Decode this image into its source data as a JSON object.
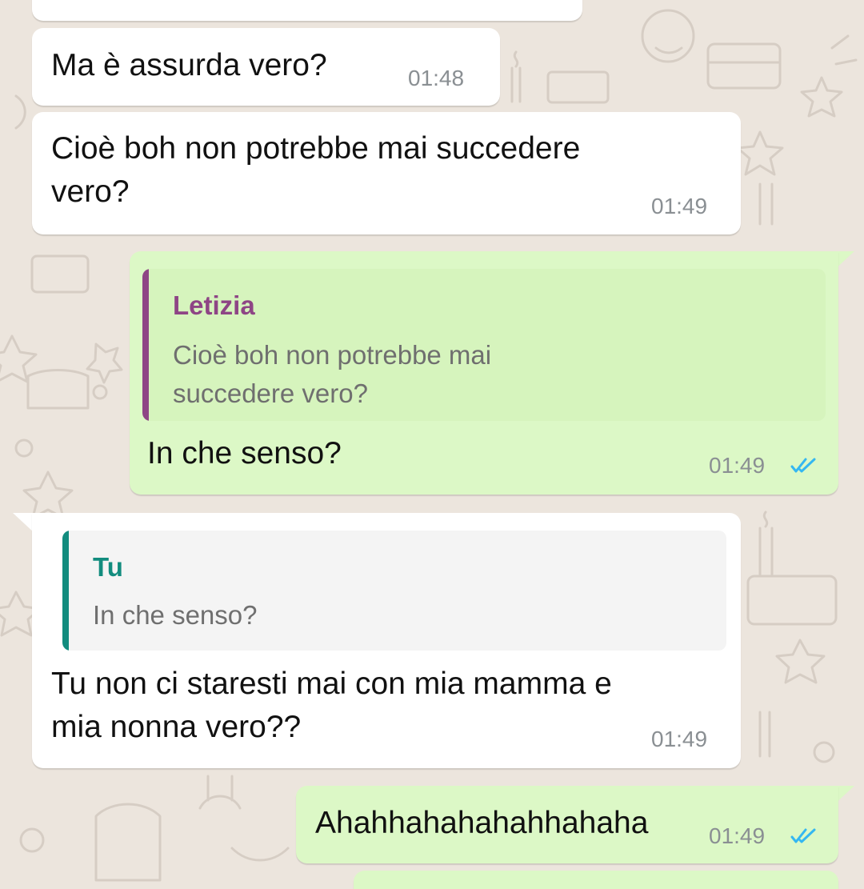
{
  "colors": {
    "background": "#ece5dd",
    "incoming_bubble": "#ffffff",
    "outgoing_bubble": "#dcf8c6",
    "read_ticks": "#34b7f1",
    "quote_author_other": "#8e4585",
    "quote_author_self": "#128c7e"
  },
  "messages": [
    {
      "direction": "incoming",
      "text": "Ma è assurda vero?",
      "time": "01:48"
    },
    {
      "direction": "incoming",
      "text": "Cioè boh non potrebbe mai succedere\nvero?",
      "time": "01:49"
    },
    {
      "direction": "outgoing",
      "quote": {
        "author": "Letizia",
        "text": "Cioè boh non potrebbe mai\nsuccedere vero?"
      },
      "text": "In che senso?",
      "time": "01:49",
      "status_icon": "double-check-read-icon"
    },
    {
      "direction": "incoming",
      "quote": {
        "author": "Tu",
        "text": "In che senso?"
      },
      "text": "Tu non ci staresti mai con mia mamma e\nmia nonna vero??",
      "time": "01:49"
    },
    {
      "direction": "outgoing",
      "text": "Ahahhahahahahhahaha",
      "time": "01:49",
      "status_icon": "double-check-read-icon"
    }
  ]
}
